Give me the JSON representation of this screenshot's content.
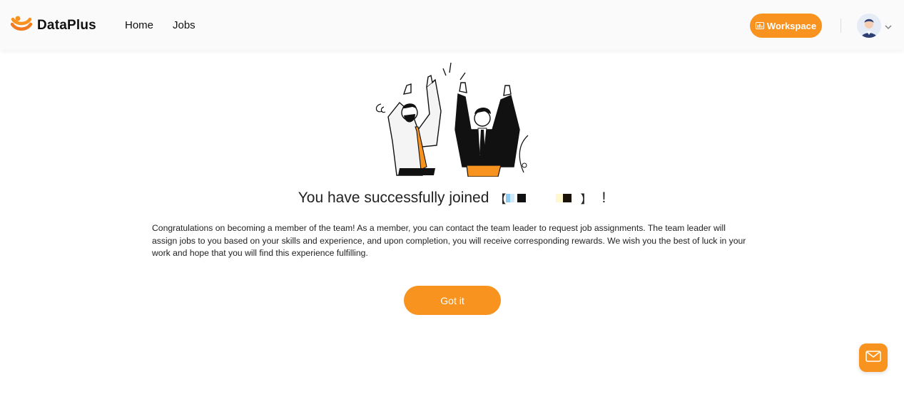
{
  "header": {
    "brand_name": "DataPlus",
    "nav": [
      {
        "label": "Home"
      },
      {
        "label": "Jobs"
      }
    ],
    "workspace_label": "Workspace"
  },
  "main": {
    "headline_prefix": "You have successfully joined",
    "headline_open_bracket": "【",
    "headline_close_bracket": "】",
    "headline_suffix": "!",
    "message": "Congratulations on becoming a member of the team! As a member, you can contact the team leader to request job assignments. The team leader will assign jobs to you based on your skills and experience, and upon completion, you will receive corresponding rewards. We wish you the best of luck in your work and hope that you will find this experience fulfilling.",
    "confirm_label": "Got it"
  },
  "colors": {
    "accent": "#f7931e",
    "text": "#222222",
    "header_bg": "#fafafa"
  },
  "icons": {
    "logo": "dataplus-logo-icon",
    "workspace": "workspace-icon",
    "avatar": "user-avatar",
    "chevron": "chevron-down-icon",
    "mail": "mail-icon"
  }
}
